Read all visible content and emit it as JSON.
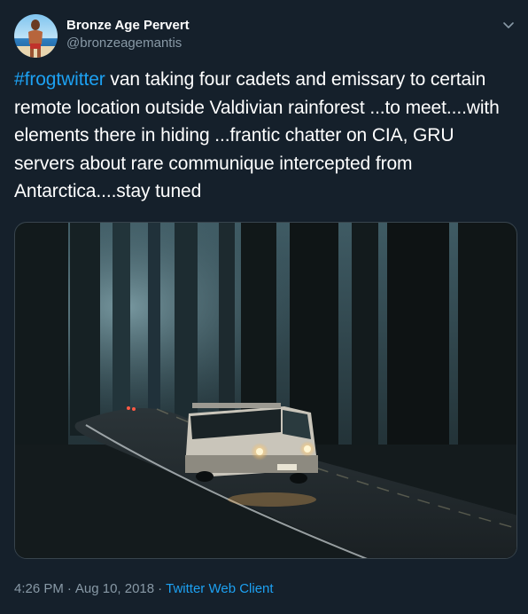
{
  "user": {
    "display_name": "Bronze Age Pervert",
    "handle": "@bronzeagemantis",
    "avatar_icon": "profile-photo"
  },
  "tweet": {
    "hashtag": "#frogtwitter",
    "text": " van taking four cadets and emissary to certain remote location outside Valdivian rainforest ...to meet....with elements there in hiding ...frantic chatter on CIA, GRU servers about rare communique intercepted from Antarctica....stay tuned"
  },
  "media": {
    "icon": "photo-forest-road-van"
  },
  "meta": {
    "time": "4:26 PM",
    "separator": "·",
    "date": "Aug 10, 2018",
    "client": "Twitter Web Client"
  },
  "colors": {
    "background": "#15202b",
    "accent": "#1da1f2",
    "secondary_text": "#8899a6",
    "border": "#38444d"
  }
}
